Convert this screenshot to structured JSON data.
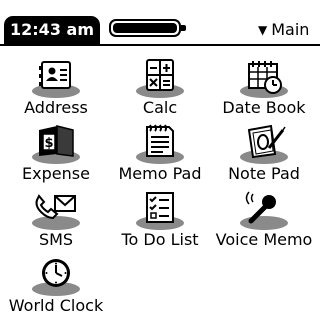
{
  "status": {
    "time": "12:43 am",
    "category": "Main"
  },
  "apps": [
    {
      "label": "Address",
      "icon": "address-book-icon"
    },
    {
      "label": "Calc",
      "icon": "calculator-icon"
    },
    {
      "label": "Date Book",
      "icon": "calendar-clock-icon"
    },
    {
      "label": "Expense",
      "icon": "expense-wallet-icon"
    },
    {
      "label": "Memo Pad",
      "icon": "memo-pad-icon"
    },
    {
      "label": "Note Pad",
      "icon": "note-pad-icon"
    },
    {
      "label": "SMS",
      "icon": "sms-phone-envelope-icon"
    },
    {
      "label": "To Do List",
      "icon": "todo-checklist-icon"
    },
    {
      "label": "Voice Memo",
      "icon": "microphone-icon"
    },
    {
      "label": "World Clock",
      "icon": "world-clock-icon"
    }
  ]
}
